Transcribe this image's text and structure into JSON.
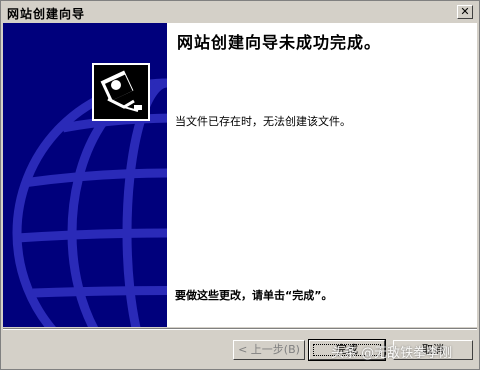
{
  "window": {
    "title": "网站创建向导"
  },
  "titlebar": {
    "close_glyph": "✕"
  },
  "main": {
    "heading": "网站创建向导未成功完成。",
    "message": "当文件已存在时，无法创建该文件。",
    "instruction": "要做这些更改，请单击“完成”。"
  },
  "buttons": {
    "back": "< 上一步(B)",
    "finish": "完成",
    "cancel": "取消"
  },
  "watermark": "头条 @无敌铁拳李刚",
  "colors": {
    "sidebar": "#00007c",
    "globe_lines": "#2a2ab8",
    "face": "#d4d0c8"
  },
  "icons": {
    "wizard": "web-wizard-icon",
    "globe": "globe-graphic"
  }
}
